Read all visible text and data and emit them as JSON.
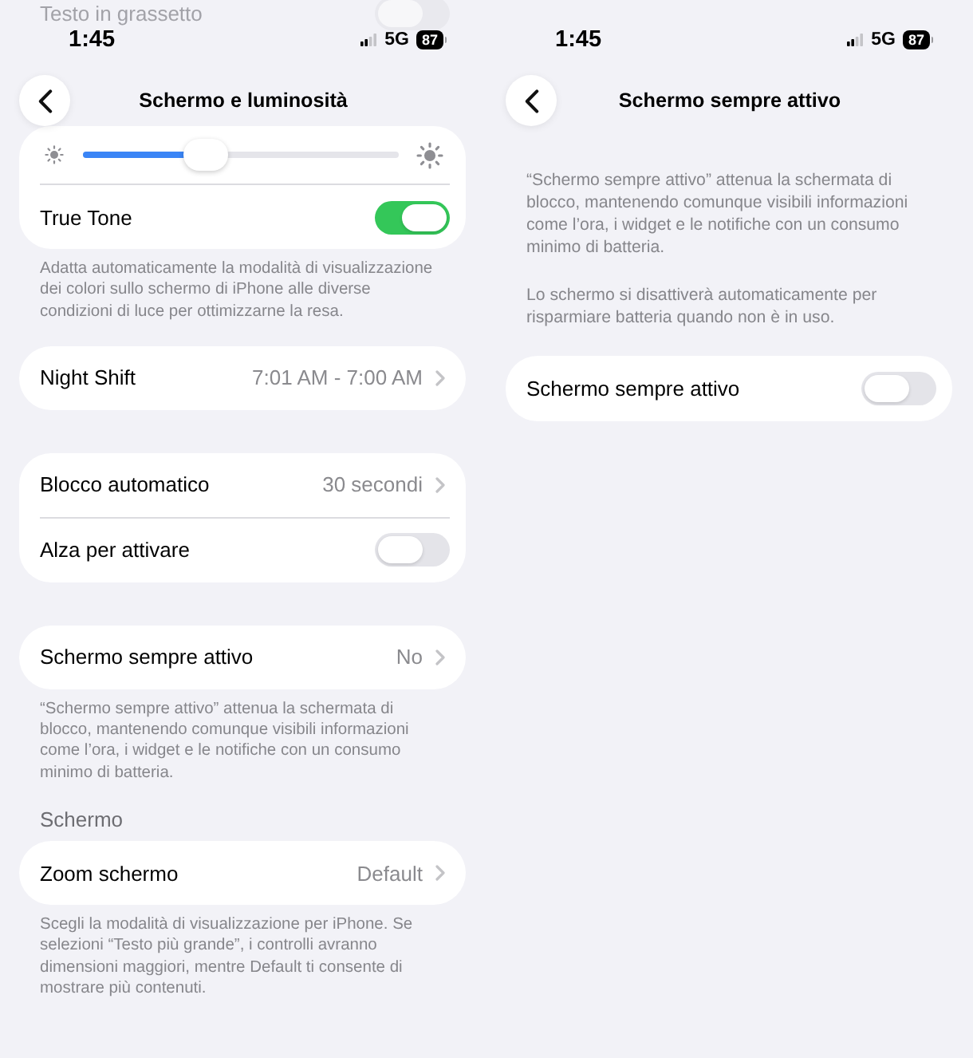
{
  "screens": [
    {
      "scrolled_under": {
        "label": "Testo in grassetto",
        "on": false
      },
      "status_bar": {
        "time": "1:45",
        "network": "5G",
        "battery": "87"
      },
      "nav": {
        "title": "Schermo e luminosità"
      },
      "sections": [
        {
          "rows": [
            {
              "kind": "slider",
              "level": 0.37
            },
            {
              "kind": "toggle",
              "label": "True Tone",
              "on": true
            }
          ],
          "footer": "Adatta automaticamente la modalità di visualizzazione dei colori sullo schermo di iPhone alle diverse condizioni di luce per ottimizzarne la resa."
        },
        {
          "rows": [
            {
              "kind": "link",
              "label": "Night Shift",
              "value": "7:01 AM - 7:00 AM"
            }
          ]
        },
        {
          "rows": [
            {
              "kind": "link",
              "label": "Blocco automatico",
              "value": "30 secondi"
            },
            {
              "kind": "toggle",
              "label": "Alza per attivare",
              "on": false
            }
          ]
        },
        {
          "rows": [
            {
              "kind": "link",
              "label": "Schermo sempre attivo",
              "value": "No"
            }
          ],
          "footer": "“Schermo sempre attivo” attenua la schermata di blocco, mantenendo comunque visibili informazioni come l’ora, i widget e le notifiche con un consumo minimo di batteria."
        },
        {
          "header": "Schermo",
          "rows": [
            {
              "kind": "link",
              "label": "Zoom schermo",
              "value": "Default"
            }
          ],
          "footer": "Scegli la modalità di visualizzazione per iPhone. Se selezioni “Testo più grande”, i controlli avranno dimensioni maggiori, mentre Default ti consente di mostrare più contenuti."
        }
      ]
    },
    {
      "status_bar": {
        "time": "1:45",
        "network": "5G",
        "battery": "87"
      },
      "nav": {
        "title": "Schermo sempre attivo"
      },
      "description": [
        "“Schermo sempre attivo” attenua la schermata di blocco, mantenendo comunque visibili informazioni come l’ora, i widget e le notifiche con un consumo minimo di batteria.",
        "Lo schermo si disattiverà automaticamente per risparmiare batteria quando non è in uso."
      ],
      "sections": [
        {
          "rows": [
            {
              "kind": "toggle",
              "label": "Schermo sempre attivo",
              "on": false
            }
          ]
        }
      ]
    }
  ]
}
